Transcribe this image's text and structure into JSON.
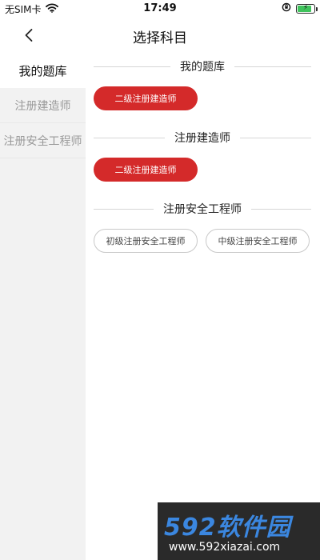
{
  "status_bar": {
    "carrier": "无SIM卡",
    "time": "17:49",
    "battery_level": 0.9,
    "battery_color": "#3fc35c"
  },
  "nav": {
    "title": "选择科目",
    "back_icon": "chevron-left-icon"
  },
  "sidebar": {
    "items": [
      {
        "label": "我的题库",
        "active": true
      },
      {
        "label": "注册建造师",
        "active": false
      },
      {
        "label": "注册安全工程师",
        "active": false
      }
    ]
  },
  "sections": [
    {
      "title": "我的题库",
      "chips": [
        {
          "label": "二级注册建造师",
          "style": "filled"
        }
      ]
    },
    {
      "title": "注册建造师",
      "chips": [
        {
          "label": "二级注册建造师",
          "style": "filled"
        }
      ]
    },
    {
      "title": "注册安全工程师",
      "chips": [
        {
          "label": "初级注册安全工程师",
          "style": "outline"
        },
        {
          "label": "中级注册安全工程师",
          "style": "outline"
        }
      ]
    }
  ],
  "colors": {
    "accent": "#d42a2a",
    "sidebar_bg": "#f2f2f2"
  },
  "watermark": {
    "logo": "592软件园",
    "url": "www.592xiazai.com"
  }
}
